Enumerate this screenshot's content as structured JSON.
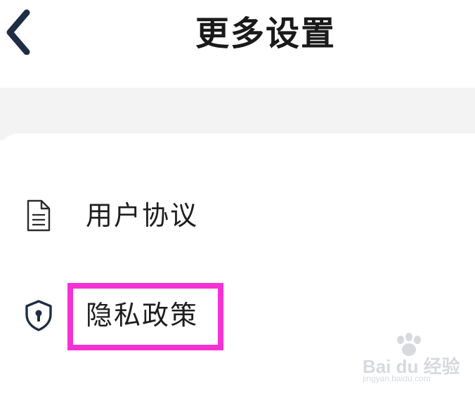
{
  "header": {
    "title": "更多设置",
    "back_icon": "chevron-left-icon"
  },
  "menu": {
    "items": [
      {
        "label": "用户协议",
        "icon": "document-icon"
      },
      {
        "label": "隐私政策",
        "icon": "shield-lock-icon",
        "highlighted": true
      }
    ]
  },
  "highlight": {
    "color": "#f531d4"
  },
  "watermark": {
    "brand": "Bai du 经验",
    "url": "jingyan.baidu.com"
  },
  "colors": {
    "background": "#ffffff",
    "separator_band": "#f3f3f4",
    "back_chevron": "#1f2e45",
    "text": "#1e1e1e"
  }
}
